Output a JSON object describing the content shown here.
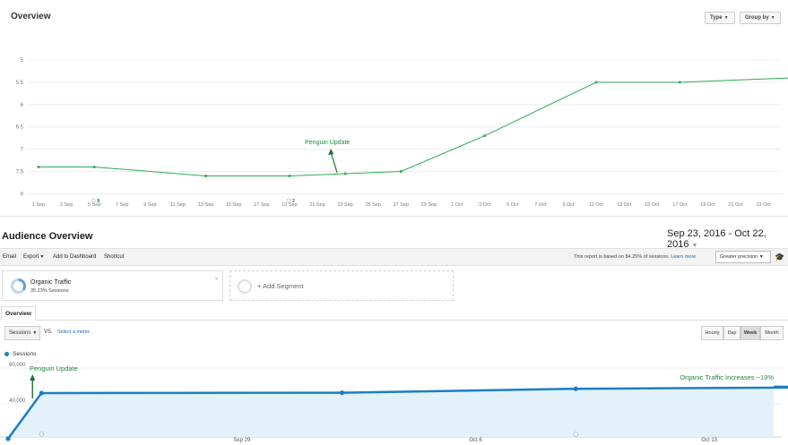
{
  "top_panel": {
    "title": "Overview",
    "type_label": "Type",
    "groupby_label": "Group by",
    "annotation": "Penguin Update",
    "marker_labels": [
      "8",
      "2"
    ],
    "y_ticks": [
      "5",
      "5.5",
      "6",
      "6.5",
      "7",
      "7.5",
      "8"
    ],
    "x_ticks": [
      "1 Sep",
      "3 Sep",
      "5 Sep",
      "7 Sep",
      "9 Sep",
      "11 Sep",
      "13 Sep",
      "15 Sep",
      "17 Sep",
      "19 Sep",
      "21 Sep",
      "23 Sep",
      "25 Sep",
      "27 Sep",
      "29 Sep",
      "1 Oct",
      "3 Oct",
      "5 Oct",
      "7 Oct",
      "9 Oct",
      "11 Oct",
      "13 Oct",
      "15 Oct",
      "17 Oct",
      "19 Oct",
      "21 Oct",
      "23 Oct"
    ],
    "line_color": "#2eaa57"
  },
  "audience": {
    "title": "Audience Overview",
    "date_range": "Sep 23, 2016 - Oct 22, 2016",
    "toolbar": {
      "email": "Email",
      "export": "Export",
      "add_to_dashboard": "Add to Dashboard",
      "shortcut": "Shortcut",
      "precision_note": "This report is based on 84.25% of sessions.",
      "learn_more": "Learn more",
      "precision_select": "Greater precision"
    },
    "segment": {
      "name": "Organic Traffic",
      "pct": "35.23% Sessions",
      "add_label": "+ Add Segment"
    },
    "tab": "Overview",
    "metric": "Sessions",
    "vs": "VS.",
    "select_metric": "Select a metric",
    "granularity": [
      "Hourly",
      "Day",
      "Week",
      "Month"
    ],
    "legend": "Sessions",
    "annotation_left": "Penguin Update",
    "annotation_right": "Organic Traffic Increases ~19%",
    "y_ticks": [
      "60,000",
      "40,000"
    ],
    "x_ticks": [
      "Sep 29",
      "Oct 6",
      "Oct 13"
    ],
    "line_color": "#1b7fc1",
    "fill_color": "#e3f1fa"
  },
  "chart_data": [
    {
      "type": "line",
      "y_axis": "reversed",
      "ylim": [
        5,
        8
      ],
      "x": [
        "1 Sep",
        "5 Sep",
        "13 Sep",
        "19 Sep",
        "23 Sep",
        "27 Sep",
        "3 Oct",
        "11 Oct",
        "17 Oct",
        "25 Oct"
      ],
      "values": [
        7.4,
        7.4,
        7.6,
        7.6,
        7.55,
        7.5,
        6.7,
        5.5,
        5.5,
        5.4
      ]
    },
    {
      "type": "area",
      "ylim": [
        20000,
        60000
      ],
      "x": [
        "Sep 22",
        "Sep 23",
        "Oct 2",
        "Oct 9",
        "Oct 18"
      ],
      "values": [
        20500,
        46000,
        46200,
        48400,
        49300
      ]
    }
  ]
}
